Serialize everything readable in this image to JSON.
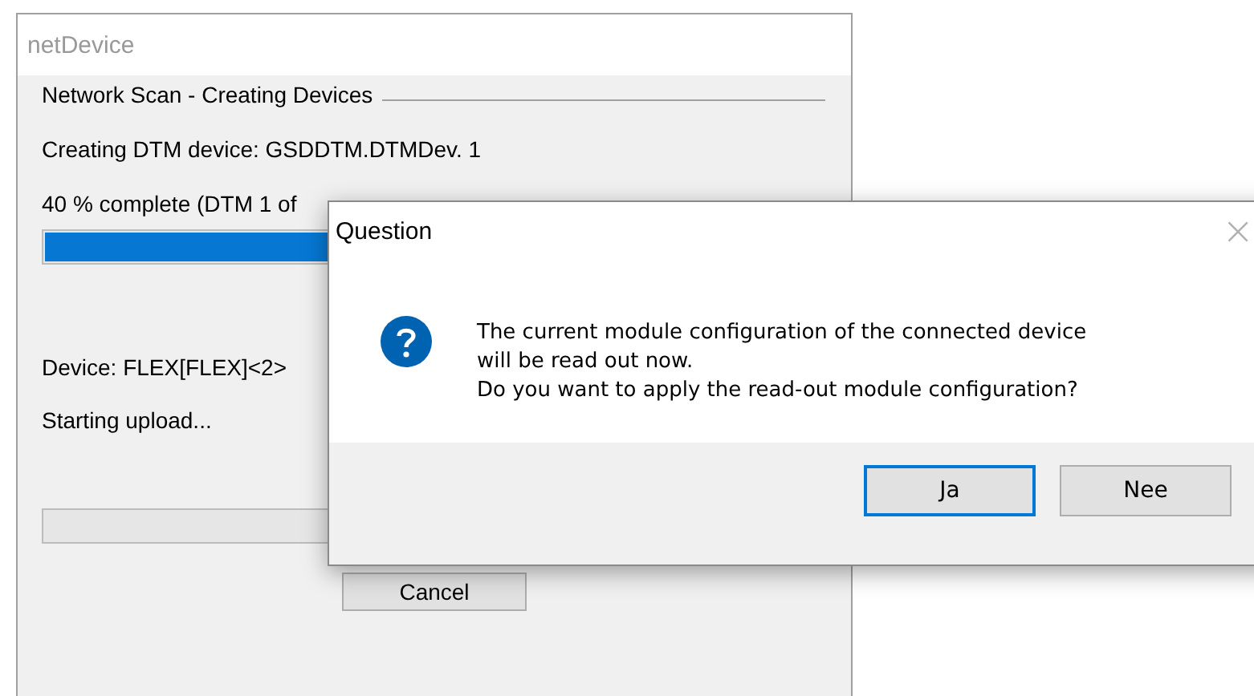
{
  "main_window": {
    "title": "netDevice",
    "group_title": "Network Scan - Creating Devices",
    "status_line": "Creating DTM device: GSDDTM.DTMDev. 1",
    "progress_text": "40 % complete (DTM 1 of",
    "progress": {
      "level": 0.4
    },
    "device_line": "Device: FLEX[FLEX]<2>",
    "upload_line": "Starting upload...",
    "cancel_button": "Cancel"
  },
  "dialog": {
    "title": "Question",
    "close": "×",
    "message_lines": [
      "The current module configuration of the connected device",
      "will be read out now.",
      "Do you want to apply the read-out module configuration?"
    ],
    "buttons": [
      {
        "label": "Ja",
        "default": true
      },
      {
        "label": "Nee",
        "default": false
      }
    ]
  }
}
